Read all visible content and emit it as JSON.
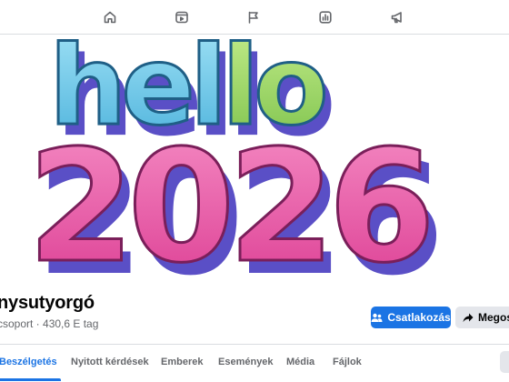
{
  "nav": {
    "icons": [
      "home-icon",
      "video-icon",
      "flag-icon",
      "chart-icon",
      "megaphone-icon"
    ]
  },
  "cover": {
    "line1": "hello",
    "line2": "2026",
    "colors": {
      "hel": "#6ec9e8",
      "lo": "#9fd66a",
      "numbers": "#ea5aa8",
      "shadow": "#5a4fc6"
    }
  },
  "group": {
    "name": "nysutyorgó",
    "meta": "csoport · 430,6 E tag"
  },
  "actions": {
    "join_label": "Csatlakozás",
    "share_label": "Megosz"
  },
  "tabs": [
    {
      "label": "Beszélgetés",
      "active": true
    },
    {
      "label": "Nyitott kérdések",
      "active": false
    },
    {
      "label": "Emberek",
      "active": false
    },
    {
      "label": "Események",
      "active": false
    },
    {
      "label": "Média",
      "active": false
    },
    {
      "label": "Fájlok",
      "active": false
    }
  ],
  "colors": {
    "accent": "#1b74e4",
    "secondary_bg": "#e4e6eb",
    "muted_text": "#65676b"
  }
}
